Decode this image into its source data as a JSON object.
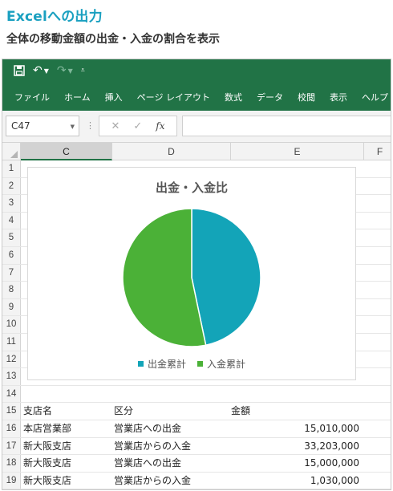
{
  "doc": {
    "title": "Excelへの出力",
    "subtitle": "全体の移動金額の出金・入金の割合を表示"
  },
  "ribbon": {
    "tabs": [
      "ファイル",
      "ホーム",
      "挿入",
      "ページ レイアウト",
      "数式",
      "データ",
      "校閲",
      "表示",
      "ヘルプ"
    ]
  },
  "formula_bar": {
    "name_box": "C47",
    "formula": ""
  },
  "columns": [
    "C",
    "D",
    "E",
    "F"
  ],
  "selected_column": "C",
  "row_numbers": [
    "1",
    "2",
    "3",
    "4",
    "5",
    "6",
    "7",
    "8",
    "9",
    "10",
    "11",
    "12",
    "13",
    "14",
    "15",
    "16",
    "17",
    "18",
    "19"
  ],
  "table": {
    "header": {
      "branch": "支店名",
      "type": "区分",
      "amount": "金額"
    },
    "rows": [
      {
        "branch": "本店営業部",
        "type": "営業店への出金",
        "amount": "15,010,000"
      },
      {
        "branch": "新大阪支店",
        "type": "営業店からの入金",
        "amount": "33,203,000"
      },
      {
        "branch": "新大阪支店",
        "type": "営業店への出金",
        "amount": "15,000,000"
      },
      {
        "branch": "新大阪支店",
        "type": "営業店からの入金",
        "amount": "1,030,000"
      }
    ]
  },
  "colors": {
    "excel_green": "#217346",
    "series_out": "#13a4b8",
    "series_in": "#4bb137"
  },
  "chart_data": {
    "type": "pie",
    "title": "出金・入金比",
    "categories": [
      "出金累計",
      "入金累計"
    ],
    "values": [
      30010000,
      34233000
    ],
    "legend_position": "bottom"
  }
}
